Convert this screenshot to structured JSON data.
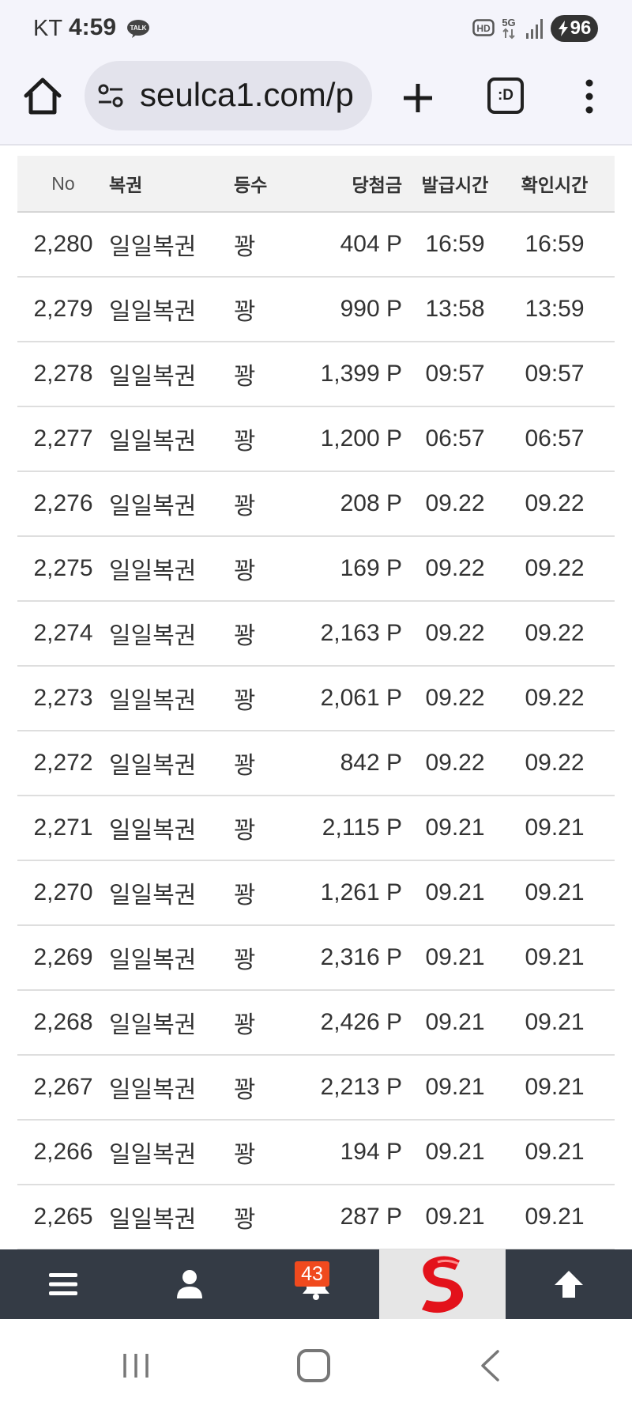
{
  "status_bar": {
    "carrier": "KT",
    "time": "4:59",
    "talk_label": "TALK",
    "hd_label": "HD",
    "network_label": "5G",
    "battery": "96"
  },
  "browser": {
    "url": "seulca1.com/p",
    "tabs_label": ":D"
  },
  "table": {
    "headers": {
      "no": "No",
      "name": "복권",
      "rank": "등수",
      "amount": "당첨금",
      "issued": "발급시간",
      "checked": "확인시간"
    },
    "rows": [
      {
        "no": "2,280",
        "name": "일일복권",
        "rank": "꽝",
        "amount": "404 P",
        "issued": "16:59",
        "checked": "16:59"
      },
      {
        "no": "2,279",
        "name": "일일복권",
        "rank": "꽝",
        "amount": "990 P",
        "issued": "13:58",
        "checked": "13:59"
      },
      {
        "no": "2,278",
        "name": "일일복권",
        "rank": "꽝",
        "amount": "1,399 P",
        "issued": "09:57",
        "checked": "09:57"
      },
      {
        "no": "2,277",
        "name": "일일복권",
        "rank": "꽝",
        "amount": "1,200 P",
        "issued": "06:57",
        "checked": "06:57"
      },
      {
        "no": "2,276",
        "name": "일일복권",
        "rank": "꽝",
        "amount": "208 P",
        "issued": "09.22",
        "checked": "09.22"
      },
      {
        "no": "2,275",
        "name": "일일복권",
        "rank": "꽝",
        "amount": "169 P",
        "issued": "09.22",
        "checked": "09.22"
      },
      {
        "no": "2,274",
        "name": "일일복권",
        "rank": "꽝",
        "amount": "2,163 P",
        "issued": "09.22",
        "checked": "09.22"
      },
      {
        "no": "2,273",
        "name": "일일복권",
        "rank": "꽝",
        "amount": "2,061 P",
        "issued": "09.22",
        "checked": "09.22"
      },
      {
        "no": "2,272",
        "name": "일일복권",
        "rank": "꽝",
        "amount": "842 P",
        "issued": "09.22",
        "checked": "09.22"
      },
      {
        "no": "2,271",
        "name": "일일복권",
        "rank": "꽝",
        "amount": "2,115 P",
        "issued": "09.21",
        "checked": "09.21"
      },
      {
        "no": "2,270",
        "name": "일일복권",
        "rank": "꽝",
        "amount": "1,261 P",
        "issued": "09.21",
        "checked": "09.21"
      },
      {
        "no": "2,269",
        "name": "일일복권",
        "rank": "꽝",
        "amount": "2,316 P",
        "issued": "09.21",
        "checked": "09.21"
      },
      {
        "no": "2,268",
        "name": "일일복권",
        "rank": "꽝",
        "amount": "2,426 P",
        "issued": "09.21",
        "checked": "09.21"
      },
      {
        "no": "2,267",
        "name": "일일복권",
        "rank": "꽝",
        "amount": "2,213 P",
        "issued": "09.21",
        "checked": "09.21"
      },
      {
        "no": "2,266",
        "name": "일일복권",
        "rank": "꽝",
        "amount": "194 P",
        "issued": "09.21",
        "checked": "09.21"
      },
      {
        "no": "2,265",
        "name": "일일복권",
        "rank": "꽝",
        "amount": "287 P",
        "issued": "09.21",
        "checked": "09.21"
      }
    ]
  },
  "bottom_nav": {
    "notification_count": "43",
    "icons": [
      "menu-icon",
      "user-icon",
      "bell-icon",
      "site-logo",
      "arrow-up-icon"
    ]
  },
  "colors": {
    "nav_background": "#343b45",
    "badge": "#f04a1e",
    "logo_red": "#e3121b"
  }
}
